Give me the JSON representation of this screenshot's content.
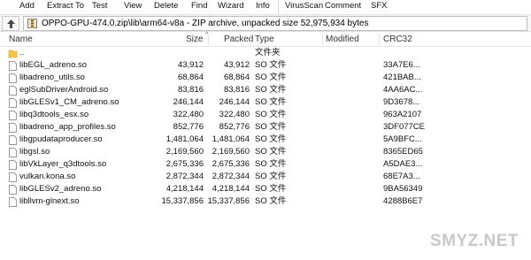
{
  "toolbar": {
    "buttons": [
      "Add",
      "Extract To",
      "Test",
      "View",
      "Delete",
      "Find",
      "Wizard",
      "Info",
      "VirusScan",
      "Comment",
      "SFX"
    ]
  },
  "address": {
    "path": "OPPO-GPU-474.0.zip\\lib\\arm64-v8a - ZIP archive, unpacked size 52,975,934 bytes"
  },
  "columns": {
    "name": "Name",
    "size": "Size",
    "packed": "Packed",
    "type": "Type",
    "modified": "Modified",
    "crc": "CRC32"
  },
  "files": [
    {
      "name": "..",
      "size": "",
      "packed": "",
      "type": "文件夹",
      "crc": "",
      "icon": "folder-icon"
    },
    {
      "name": "libEGL_adreno.so",
      "size": "43,912",
      "packed": "43,912",
      "type": "SO 文件",
      "crc": "33A7E6...",
      "icon": "file-icon"
    },
    {
      "name": "libadreno_utils.so",
      "size": "68,864",
      "packed": "68,864",
      "type": "SO 文件",
      "crc": "421BAB...",
      "icon": "file-icon"
    },
    {
      "name": "eglSubDriverAndroid.so",
      "size": "83,816",
      "packed": "83,816",
      "type": "SO 文件",
      "crc": "4AA6AC...",
      "icon": "file-icon"
    },
    {
      "name": "libGLESv1_CM_adreno.so",
      "size": "246,144",
      "packed": "246,144",
      "type": "SO 文件",
      "crc": "9D3678...",
      "icon": "file-icon"
    },
    {
      "name": "libq3dtools_esx.so",
      "size": "322,480",
      "packed": "322,480",
      "type": "SO 文件",
      "crc": "963A2107",
      "icon": "file-icon"
    },
    {
      "name": "libadreno_app_profiles.so",
      "size": "852,776",
      "packed": "852,776",
      "type": "SO 文件",
      "crc": "3DF077CE",
      "icon": "file-icon"
    },
    {
      "name": "libgpudataproducer.so",
      "size": "1,481,064",
      "packed": "1,481,064",
      "type": "SO 文件",
      "crc": "5A9BFC...",
      "icon": "file-icon"
    },
    {
      "name": "libgsl.so",
      "size": "2,169,560",
      "packed": "2,169,560",
      "type": "SO 文件",
      "crc": "8365ED65",
      "icon": "file-icon"
    },
    {
      "name": "libVkLayer_q3dtools.so",
      "size": "2,675,336",
      "packed": "2,675,336",
      "type": "SO 文件",
      "crc": "A5DAE3...",
      "icon": "file-icon"
    },
    {
      "name": "vulkan.kona.so",
      "size": "2,872,344",
      "packed": "2,872,344",
      "type": "SO 文件",
      "crc": "68E7A3...",
      "icon": "file-icon"
    },
    {
      "name": "libGLESv2_adreno.so",
      "size": "4,218,144",
      "packed": "4,218,144",
      "type": "SO 文件",
      "crc": "9BA56349",
      "icon": "file-icon"
    },
    {
      "name": "libllvm-glnext.so",
      "size": "15,337,856",
      "packed": "15,337,856",
      "type": "SO 文件",
      "crc": "4288B6E7",
      "icon": "file-icon"
    }
  ],
  "watermark": "SMYZ.NET",
  "colors": {
    "folder": "#f3c34a",
    "file_border": "#9a9a9a",
    "header_border": "#e5e5e5"
  }
}
